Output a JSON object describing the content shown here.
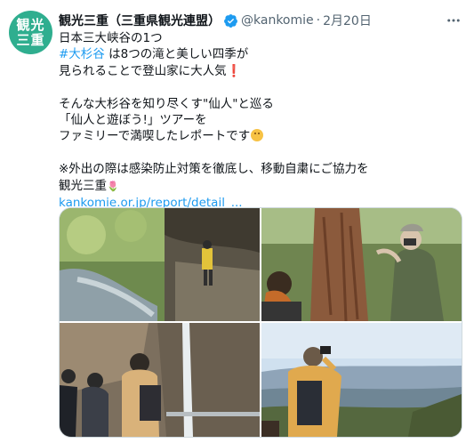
{
  "account": {
    "avatar_text_top": "観光",
    "avatar_text_bottom": "三重",
    "name": "観光三重（三重県観光連盟）",
    "handle": "@kankomie",
    "separator": "·",
    "date": "2月20日"
  },
  "tweet": {
    "line1": "日本三大峡谷の1つ",
    "hashtag": "#大杉谷",
    "line2_rest": " は8つの滝と美しい四季が",
    "line3": "見られることで登山家に大人気",
    "line3_emoji": "❗",
    "line4": "そんな大杉谷を知り尽くす\"仙人\"と巡る",
    "line5": "「仙人と遊ぼう!」ツアーを",
    "line6": "ファミリーで満喫したレポートです",
    "line7": "※外出の際は感染防止対策を徹底し、移動自粛にご協力を",
    "line8": "観光三重",
    "line8_emoji": "🌷",
    "url": "kankomie.or.jp/report/detail_..."
  },
  "icons": {
    "verified": "verified-badge-icon",
    "more": "more-options-icon"
  },
  "colors": {
    "accent": "#1d9bf0",
    "avatar": "#2fae8f",
    "muted": "#536471"
  }
}
